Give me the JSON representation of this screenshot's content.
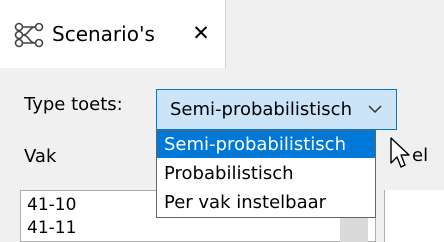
{
  "tab": {
    "icon": "scenarios-icon",
    "label": "Scenario's",
    "close_label": "✕"
  },
  "form": {
    "type_label": "Type toets:",
    "select_value": "Semi-probabilistisch",
    "vak_label": "Vak",
    "right_label": "el"
  },
  "dropdown": {
    "options": [
      "Semi-probabilistisch",
      "Probabilistisch",
      "Per vak instelbaar"
    ],
    "selected_index": 0
  },
  "list": {
    "items": [
      "41-10",
      "41-11"
    ]
  },
  "colors": {
    "accent": "#0078d7",
    "select_bg": "#cce4f7",
    "panel_bg": "#f0f0f0"
  }
}
